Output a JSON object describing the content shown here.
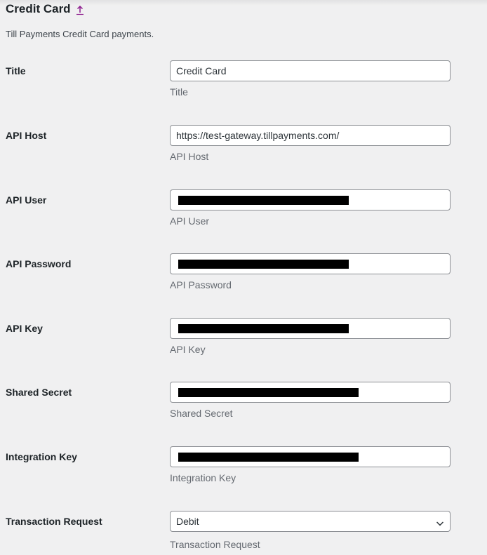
{
  "section": {
    "title": "Credit Card",
    "link_icon": "arrow-up-icon",
    "description": "Till Payments Credit Card payments."
  },
  "fields": [
    {
      "key": "title",
      "label": "Title",
      "value": "Credit Card",
      "help": "Title",
      "redacted": false
    },
    {
      "key": "api_host",
      "label": "API Host",
      "value": "https://test-gateway.tillpayments.com/",
      "help": "API Host",
      "redacted": false
    },
    {
      "key": "api_user",
      "label": "API User",
      "value": "",
      "help": "API User",
      "redacted": true
    },
    {
      "key": "api_password",
      "label": "API Password",
      "value": "",
      "help": "API Password",
      "redacted": true
    },
    {
      "key": "api_key",
      "label": "API Key",
      "value": "",
      "help": "API Key",
      "redacted": true
    },
    {
      "key": "shared_secret",
      "label": "Shared Secret",
      "value": "",
      "help": "Shared Secret",
      "redacted": true
    },
    {
      "key": "integration_key",
      "label": "Integration Key",
      "value": "",
      "help": "Integration Key",
      "redacted": true
    }
  ],
  "transaction_request": {
    "label": "Transaction Request",
    "selected": "Debit",
    "help": "Transaction Request",
    "icon": "chevron-down-icon"
  },
  "colors": {
    "background": "#f0f0f1",
    "field_border": "#8c8f94",
    "link_icon": "#8c1a8c",
    "redaction": "#000000"
  }
}
